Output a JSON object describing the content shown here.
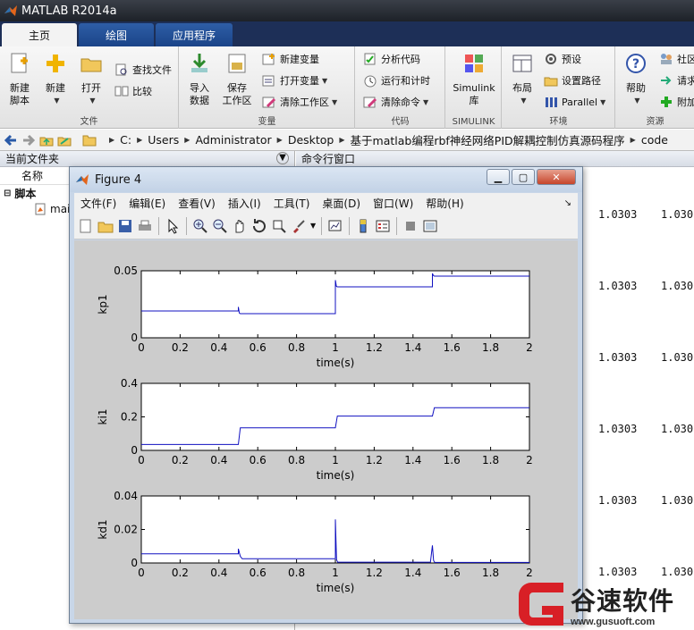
{
  "window": {
    "title": "MATLAB R2014a"
  },
  "tabs": [
    {
      "label": "主页",
      "active": true
    },
    {
      "label": "绘图",
      "active": false
    },
    {
      "label": "应用程序",
      "active": false
    }
  ],
  "ribbon": {
    "file": {
      "group_name": "文件",
      "new_script": "新建\n脚本",
      "new": "新建",
      "open": "打开",
      "find_files": "查找文件",
      "compare": "比较"
    },
    "variable": {
      "group_name": "变量",
      "import": "导入\n数据",
      "save_ws": "保存\n工作区",
      "new_var": "新建变量",
      "open_var": "打开变量",
      "clear_ws": "清除工作区"
    },
    "code": {
      "group_name": "代码",
      "analyze": "分析代码",
      "run_time": "运行和计时",
      "clear_cmd": "清除命令"
    },
    "simulink": {
      "group_name": "SIMULINK",
      "label": "Simulink\n库"
    },
    "env": {
      "group_name": "环境",
      "layout": "布局",
      "prefs": "预设",
      "set_path": "设置路径",
      "parallel": "Parallel"
    },
    "resources": {
      "group_name": "资源",
      "help": "帮助",
      "community": "社区",
      "request": "请求",
      "addons": "附加"
    }
  },
  "address": {
    "crumbs": [
      "C:",
      "Users",
      "Administrator",
      "Desktop",
      "基于matlab编程rbf神经网络PID解耦控制仿真源码程序",
      "code"
    ]
  },
  "left_panel": {
    "title": "当前文件夹",
    "col_name": "名称",
    "group": "脚本",
    "file": "mai"
  },
  "right_panel": {
    "title": "命令行窗口",
    "col1": [
      "1.0303",
      "1.0303",
      "1.0303",
      "1.0303",
      "1.0303",
      "1.0303"
    ],
    "col2": [
      "1.030",
      "1.030",
      "1.030",
      "1.030",
      "1.030",
      "1.030"
    ]
  },
  "figure": {
    "title": "Figure 4",
    "menu": [
      "文件(F)",
      "编辑(E)",
      "查看(V)",
      "插入(I)",
      "工具(T)",
      "桌面(D)",
      "窗口(W)",
      "帮助(H)"
    ]
  },
  "chart_data": [
    {
      "type": "line",
      "ylabel": "kp1",
      "xlabel": "time(s)",
      "xlim": [
        0,
        2
      ],
      "ylim": [
        0,
        0.05
      ],
      "xticks": [
        0,
        0.2,
        0.4,
        0.6,
        0.8,
        1,
        1.2,
        1.4,
        1.6,
        1.8,
        2
      ],
      "yticks": [
        0,
        0.05
      ],
      "x": [
        0,
        0.5,
        0.5,
        0.505,
        0.51,
        1.0,
        1.0,
        1.005,
        1.01,
        1.5,
        1.5,
        1.505,
        1.51,
        2.0
      ],
      "y": [
        0.02,
        0.02,
        0.023,
        0.0185,
        0.018,
        0.018,
        0.043,
        0.0385,
        0.038,
        0.038,
        0.048,
        0.0465,
        0.046,
        0.046
      ]
    },
    {
      "type": "line",
      "ylabel": "ki1",
      "xlabel": "time(s)",
      "xlim": [
        0,
        2
      ],
      "ylim": [
        0,
        0.4
      ],
      "xticks": [
        0,
        0.2,
        0.4,
        0.6,
        0.8,
        1,
        1.2,
        1.4,
        1.6,
        1.8,
        2
      ],
      "yticks": [
        0,
        0.2,
        0.4
      ],
      "x": [
        0,
        0.5,
        0.51,
        1.0,
        1.01,
        1.5,
        1.51,
        2.0
      ],
      "y": [
        0.035,
        0.035,
        0.135,
        0.135,
        0.205,
        0.205,
        0.255,
        0.255
      ]
    },
    {
      "type": "line",
      "ylabel": "kd1",
      "xlabel": "time(s)",
      "xlim": [
        0,
        2
      ],
      "ylim": [
        0,
        0.04
      ],
      "xticks": [
        0,
        0.2,
        0.4,
        0.6,
        0.8,
        1,
        1.2,
        1.4,
        1.6,
        1.8,
        2
      ],
      "yticks": [
        0,
        0.02,
        0.04
      ],
      "x": [
        0,
        0.5,
        0.5,
        0.51,
        0.52,
        1.0,
        1.0,
        1.006,
        1.012,
        1.49,
        1.5,
        1.506,
        1.512,
        2.0
      ],
      "y": [
        0.0055,
        0.0055,
        0.0085,
        0.004,
        0.0025,
        0.0025,
        0.026,
        0.002,
        0.0005,
        0.0005,
        0.0105,
        0.0015,
        0.0003,
        0.0003
      ]
    }
  ],
  "watermark": {
    "text": "谷速软件",
    "url": "www.gusuoft.com"
  },
  "colors": {
    "plot_line": "#1010c0",
    "ribbon_tabs": "#1d2f57"
  }
}
